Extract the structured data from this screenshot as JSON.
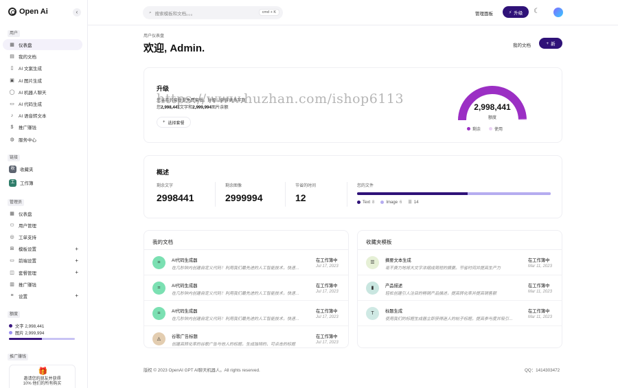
{
  "brand": {
    "name": "Open Ai"
  },
  "sidebar": {
    "section_user": "用户",
    "user_items": [
      {
        "label": "仪表盘",
        "icon": "grid-icon"
      },
      {
        "label": "我的文档",
        "icon": "archive-icon"
      },
      {
        "label": "AI 文案生成",
        "icon": "doc-icon"
      },
      {
        "label": "AI 图片生成",
        "icon": "image-icon"
      },
      {
        "label": "AI 机器人聊天",
        "icon": "chat-icon"
      },
      {
        "label": "AI 代码生成",
        "icon": "terminal-icon"
      },
      {
        "label": "AI 语音转文本",
        "icon": "mic-icon"
      },
      {
        "label": "推广赚钱",
        "icon": "dollar-icon"
      },
      {
        "label": "服务中心",
        "icon": "globe-icon"
      }
    ],
    "section_links": "链接",
    "link_items": [
      {
        "label": "收藏夹",
        "badge": "收",
        "color": "#5d6470"
      },
      {
        "label": "工作簿",
        "badge": "工",
        "color": "#2f7d6a"
      }
    ],
    "section_admin": "管理员",
    "admin_items": [
      {
        "label": "仪表盘",
        "icon": "grid-icon",
        "plus": ""
      },
      {
        "label": "用户管理",
        "icon": "users-icon",
        "plus": ""
      },
      {
        "label": "工单支持",
        "icon": "support-icon",
        "plus": ""
      },
      {
        "label": "模板设置",
        "icon": "template-icon",
        "plus": "+"
      },
      {
        "label": "前端设置",
        "icon": "monitor-icon",
        "plus": "+"
      },
      {
        "label": "套餐管理",
        "icon": "package-icon",
        "plus": "+"
      },
      {
        "label": "推广赚钱",
        "icon": "money-icon",
        "plus": ""
      },
      {
        "label": "设置",
        "icon": "sliders-icon",
        "plus": "+"
      }
    ],
    "section_quota": "额度",
    "quota": {
      "text_label": "文字 2,998,441",
      "image_label": "图片 2,999,994",
      "text_color": "#3a1780",
      "image_color": "#9b90f0",
      "fill_fraction": 0.5
    },
    "section_promo": "推广赚钱",
    "promo": {
      "line1": "邀请您的朋友并获得",
      "line2": "10% 他们的所有购买"
    }
  },
  "topbar": {
    "search_placeholder": "搜索模板和文档。。。",
    "shortcut": "cmd + K",
    "admin_link": "管理面板",
    "upgrade_label": "升级"
  },
  "header": {
    "breadcrumb": "用户仪表盘",
    "title": "欢迎, Admin.",
    "my_docs_button": "我的文档",
    "new_button": "新"
  },
  "upgrade_card": {
    "title": "升级",
    "line1": "您当前的套餐是免费套餐。升级以获得更多字数",
    "line2_pre": "您",
    "words": "2,998,441",
    "line2_mid": "文字和",
    "images": "2,999,994",
    "line2_post": "图片余额",
    "choose_plan": "选择套餐",
    "gauge_value": "2,998,441",
    "gauge_label": "额度",
    "legend_remaining": "剩余",
    "legend_used": "使用",
    "remaining_color": "#9b2fc4",
    "used_color": "#ecd3f5",
    "remaining_fraction": 0.99
  },
  "watermark": "https://www.huzhan.com/ishop6113",
  "overview": {
    "title": "概述",
    "stats": [
      {
        "label": "剩余文字",
        "value": "2998441"
      },
      {
        "label": "剩余图像",
        "value": "2999994"
      },
      {
        "label": "节省的时间",
        "value": "12"
      }
    ],
    "files_label": "您的文件",
    "files": [
      {
        "name": "Text",
        "count": "8",
        "color": "#2f1278",
        "share": 0.57
      },
      {
        "name": "Image",
        "count": "6",
        "color": "#b5acf0",
        "share": 0.43
      }
    ],
    "files_total": "14"
  },
  "my_docs": {
    "title": "我的文档",
    "rows": [
      {
        "icon": "code-icon",
        "glyph": "⌗",
        "bg": "#7be0b2",
        "title": "AI代码生成器",
        "desc": "在几秒钟内创建自定义代码！利用我们最先进的人工智能技术，快速生成",
        "status": "在工作簿中",
        "date": "Jul 17, 2023"
      },
      {
        "icon": "code-icon",
        "glyph": "⌗",
        "bg": "#7be0b2",
        "title": "AI代码生成器",
        "desc": "在几秒钟内创建自定义代码！利用我们最先进的人工智能技术，快速生成",
        "status": "在工作簿中",
        "date": "Jul 17, 2023"
      },
      {
        "icon": "code-icon",
        "glyph": "⌗",
        "bg": "#7be0b2",
        "title": "AI代码生成器",
        "desc": "在几秒钟内创建自定义代码！利用我们最先进的人工智能技术，快速生成",
        "status": "在工作簿中",
        "date": "Jul 17, 2023"
      },
      {
        "icon": "ad-icon",
        "glyph": "◬",
        "bg": "#e3cdb0",
        "title": "谷歌广告标题",
        "desc": "创建高转化率的谷歌广告与他人的标题，生成独特的、可点击的标题",
        "status": "在工作簿中",
        "date": "Jul 17, 2023"
      }
    ]
  },
  "favorites": {
    "title": "收藏夹模板",
    "rows": [
      {
        "icon": "summary-icon",
        "glyph": "☰",
        "bg": "#e6f0d6",
        "title": "摘要文本生成",
        "desc": "毫不费力地将大文字浓缩成简短的摘要。节省时间并提高生产力",
        "status": "在工作簿中",
        "date": "Mar 11, 2023"
      },
      {
        "icon": "product-icon",
        "glyph": "▮",
        "bg": "#c9e6e0",
        "title": "产品描述",
        "desc": "轻松创建引人注目的畅销产品描述，提高转化率并提高销售额",
        "status": "在工作簿中",
        "date": "Mar 11, 2023"
      },
      {
        "icon": "title-icon",
        "glyph": "T",
        "bg": "#cfe9e4",
        "title": "标题生成",
        "desc": "使用我们的标题生成器立即获得迷人的帖子标题，提高参与度并吸引读者",
        "status": "在工作簿中",
        "date": "Mar 11, 2023"
      }
    ]
  },
  "footer": {
    "copyright": "版权 © 2023 OpenAI GPT AI聊天机器人。All rights reserved.",
    "qq": "QQ：1414303472"
  },
  "colors": {
    "accent": "#2f1278",
    "gauge": "#9b2fc4"
  }
}
